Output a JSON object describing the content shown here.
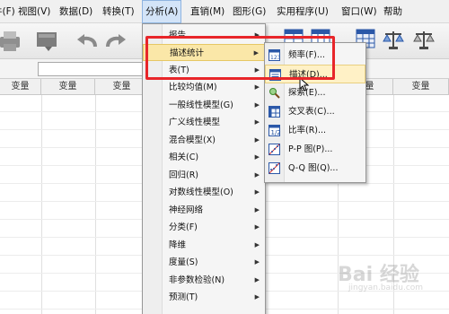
{
  "menubar": {
    "items": [
      {
        "label": "件(F)"
      },
      {
        "label": "视图(V)"
      },
      {
        "label": "数据(D)"
      },
      {
        "label": "转换(T)"
      },
      {
        "label": "分析(A)"
      },
      {
        "label": "直销(M)"
      },
      {
        "label": "图形(G)"
      },
      {
        "label": "实用程序(U)"
      },
      {
        "label": "窗口(W)"
      },
      {
        "label": "帮助"
      }
    ],
    "active_index": 4
  },
  "grid": {
    "column_header": "变量"
  },
  "analyze_menu": {
    "items": [
      {
        "label": "报告",
        "submenu": true
      },
      {
        "label": "描述统计",
        "submenu": true
      },
      {
        "label": "表(T)",
        "submenu": true
      },
      {
        "label": "比较均值(M)",
        "submenu": true
      },
      {
        "label": "一般线性模型(G)",
        "submenu": true
      },
      {
        "label": "广义线性模型",
        "submenu": true
      },
      {
        "label": "混合模型(X)",
        "submenu": true
      },
      {
        "label": "相关(C)",
        "submenu": true
      },
      {
        "label": "回归(R)",
        "submenu": true
      },
      {
        "label": "对数线性模型(O)",
        "submenu": true
      },
      {
        "label": "神经网络",
        "submenu": true
      },
      {
        "label": "分类(F)",
        "submenu": true
      },
      {
        "label": "降维",
        "submenu": true
      },
      {
        "label": "度量(S)",
        "submenu": true
      },
      {
        "label": "非参数检验(N)",
        "submenu": true
      },
      {
        "label": "预测(T)",
        "submenu": true
      }
    ],
    "highlighted_index": 1
  },
  "descriptive_submenu": {
    "items": [
      {
        "label": "频率(F)...",
        "icon": "frequencies-icon"
      },
      {
        "label": "描述(D)...",
        "icon": "descriptives-icon"
      },
      {
        "label": "探索(E)...",
        "icon": "explore-icon"
      },
      {
        "label": "交叉表(C)...",
        "icon": "crosstabs-icon"
      },
      {
        "label": "比率(R)...",
        "icon": "ratio-icon"
      },
      {
        "label": "P-P 图(P)...",
        "icon": "pp-plot-icon"
      },
      {
        "label": "Q-Q 图(Q)...",
        "icon": "qq-plot-icon"
      }
    ],
    "highlighted_index": 1
  },
  "watermark": {
    "text": "Bai 经验",
    "url": "jingyan.baidu.com"
  },
  "colors": {
    "highlight_annotation": "#e8262a",
    "menu_highlight": "#fae7a8"
  }
}
